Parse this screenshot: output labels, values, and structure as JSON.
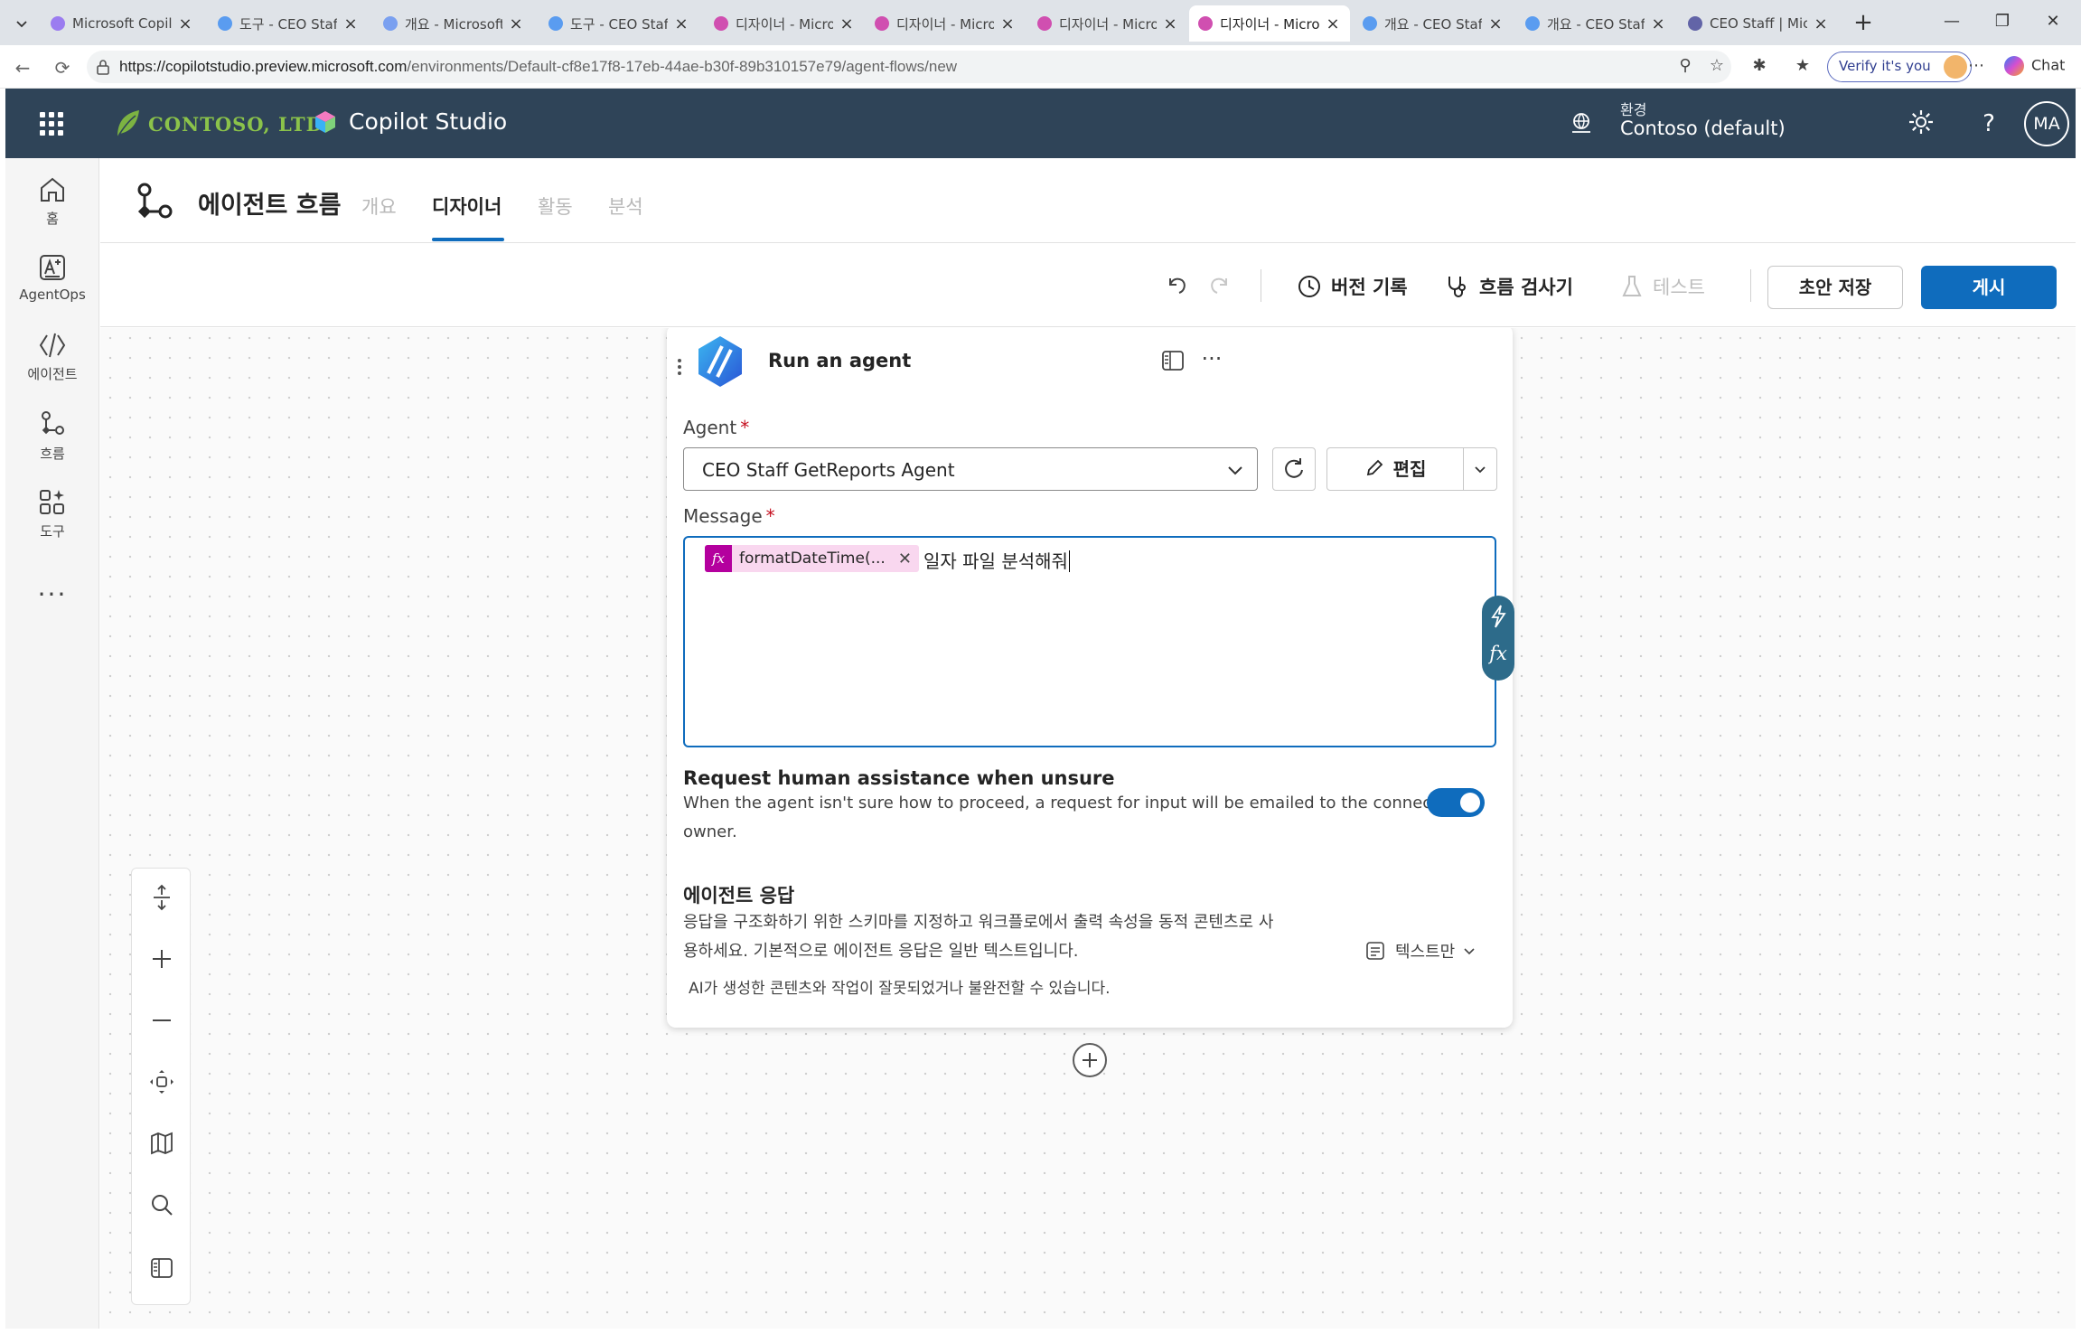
{
  "browser": {
    "tabs": [
      {
        "title": "Microsoft Copilot",
        "favicon_color": "#9b7cf0",
        "active": false
      },
      {
        "title": "도구 - CEO Staff",
        "favicon_color": "#5a9cf0",
        "active": false
      },
      {
        "title": "개요 - Microsoft",
        "favicon_color": "#7aa0f0",
        "active": false
      },
      {
        "title": "도구 - CEO Staff",
        "favicon_color": "#5a9cf0",
        "active": false
      },
      {
        "title": "디자이너 - Micro",
        "favicon_color": "#d04fb0",
        "active": false
      },
      {
        "title": "디자이너 - Micro",
        "favicon_color": "#d04fb0",
        "active": false
      },
      {
        "title": "디자이너 - Micro",
        "favicon_color": "#d04fb0",
        "active": false
      },
      {
        "title": "디자이너 - Micro",
        "favicon_color": "#d04fb0",
        "active": true
      },
      {
        "title": "개요 - CEO Staff",
        "favicon_color": "#5a9cf0",
        "active": false
      },
      {
        "title": "개요 - CEO Staff",
        "favicon_color": "#5a9cf0",
        "active": false
      },
      {
        "title": "CEO Staff | Micro",
        "favicon_color": "#6264a7",
        "active": false
      }
    ],
    "url_host": "https://copilotstudio.preview.microsoft.com",
    "url_path": "/environments/Default-cf8e17f8-17eb-44ae-b30f-89b310157e79/agent-flows/new",
    "verify_label": "Verify it's you",
    "chat_label": "Chat"
  },
  "header": {
    "org_name": "CONTOSO, LTD.",
    "app_name": "Copilot Studio",
    "env_label": "환경",
    "env_value": "Contoso (default)",
    "avatar_initials": "MA",
    "accent": "#2f4458"
  },
  "rail": {
    "items": [
      {
        "label": "홈",
        "icon": "home-icon"
      },
      {
        "label": "AgentOps",
        "icon": "agentops-icon"
      },
      {
        "label": "에이전트",
        "icon": "agent-icon"
      },
      {
        "label": "흐름",
        "icon": "flow-icon"
      },
      {
        "label": "도구",
        "icon": "tools-icon"
      }
    ],
    "more": "···"
  },
  "page": {
    "title": "에이전트 흐름",
    "tabs": [
      {
        "label": "개요",
        "active": false
      },
      {
        "label": "디자이너",
        "active": true
      },
      {
        "label": "활동",
        "active": false
      },
      {
        "label": "분석",
        "active": false
      }
    ]
  },
  "toolbar": {
    "version_history": "버전 기록",
    "flow_checker": "흐름 검사기",
    "test": "테스트",
    "save_draft": "초안 저장",
    "publish": "게시",
    "primary_color": "#0f6cbd"
  },
  "card": {
    "title": "Run an agent",
    "agent_label": "Agent",
    "required_mark": "*",
    "agent_value": "CEO Staff GetReports Agent",
    "edit_label": "편집",
    "message_label": "Message",
    "token_label": "formatDateTime(...",
    "token_fx": "fx",
    "message_text": "일자 파일 분석해줘",
    "pill_fx": "fx",
    "human_title": "Request human assistance when unsure",
    "human_desc_line1": "When the agent isn't sure how to proceed, a request for input will be emailed to the connection",
    "human_desc_line2": "owner.",
    "human_toggle_on": true,
    "response_title": "에이전트 응답",
    "response_desc_line1": "응답을 구조화하기 위한 스키마를 지정하고 워크플로에서 출력 속성을 동적 콘텐츠로 사",
    "response_desc_line2": "용하세요. 기본적으로 에이전트 응답은 일반 텍스트입니다.",
    "response_type": "텍스트만",
    "ai_note": "AI가 생성한 콘텐츠와 작업이 잘못되었거나 불완전할 수 있습니다."
  }
}
